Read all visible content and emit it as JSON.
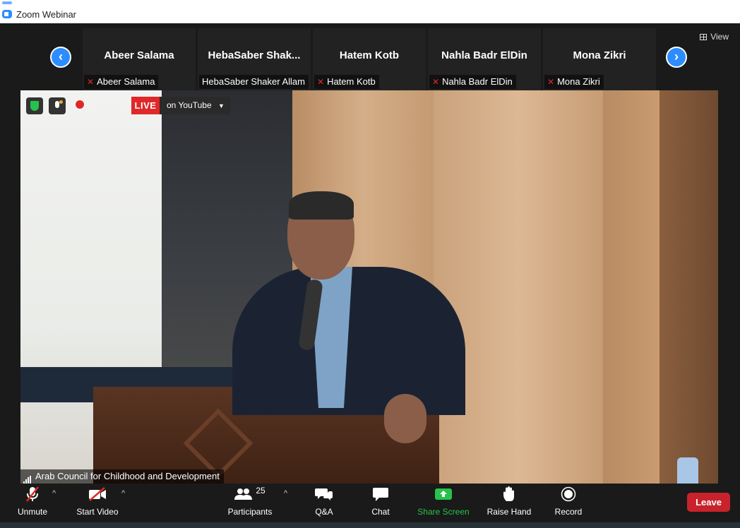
{
  "window": {
    "title": "Zoom Webinar"
  },
  "gallery": {
    "view_label": "View",
    "tiles": [
      {
        "name": "Abeer Salama",
        "tag": "Abeer Salama",
        "muted": true
      },
      {
        "name": "HebaSaber  Shak...",
        "tag": "HebaSaber Shaker Allam",
        "muted": false
      },
      {
        "name": "Hatem Kotb",
        "tag": "Hatem Kotb",
        "muted": true
      },
      {
        "name": "Nahla Badr ElDin",
        "tag": "Nahla Badr ElDin",
        "muted": true
      },
      {
        "name": "Mona Zikri",
        "tag": "Mona Zikri",
        "muted": true
      }
    ]
  },
  "main_video": {
    "live_label": "LIVE",
    "stream_label": "on YouTube",
    "speaker_label": "Arab Council for Childhood and Development"
  },
  "toolbar": {
    "unmute": "Unmute",
    "start_video": "Start Video",
    "participants": "Participants",
    "participants_count": "25",
    "qa": "Q&A",
    "chat": "Chat",
    "share_screen": "Share Screen",
    "raise_hand": "Raise Hand",
    "record": "Record",
    "leave": "Leave"
  },
  "colors": {
    "accent": "#2d8cff",
    "live": "#e02828",
    "share": "#27c24c",
    "leave": "#c8232c"
  }
}
